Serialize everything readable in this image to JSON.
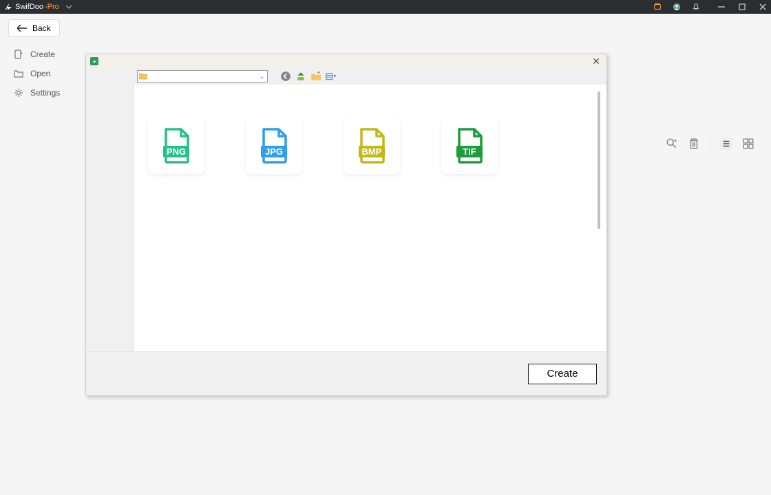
{
  "titlebar": {
    "brand": "SwifDoo",
    "suffix": "-Pro"
  },
  "back": {
    "label": "Back"
  },
  "sidebar": {
    "items": [
      {
        "label": "Create"
      },
      {
        "label": "Open"
      },
      {
        "label": "Settings"
      }
    ]
  },
  "dialog": {
    "path_value": "",
    "create_label": "Create",
    "files": [
      {
        "ext": "PNG",
        "color": "#27c088"
      },
      {
        "ext": "JPG",
        "color": "#2f9eed"
      },
      {
        "ext": "BMP",
        "color": "#c2b919"
      },
      {
        "ext": "TIF",
        "color": "#1e9b3c"
      }
    ]
  }
}
